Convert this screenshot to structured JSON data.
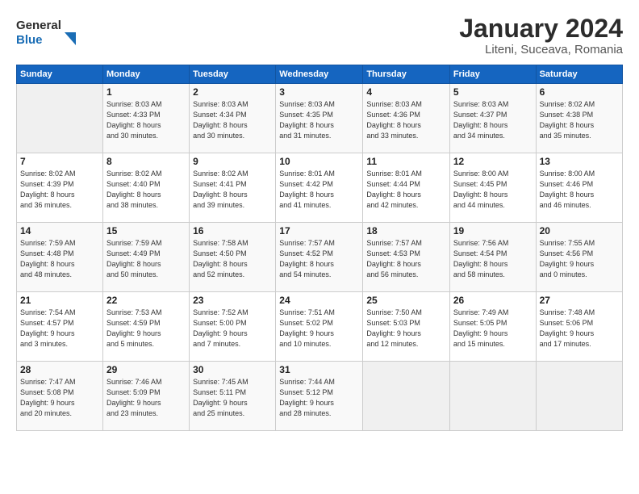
{
  "header": {
    "logo_general": "General",
    "logo_blue": "Blue",
    "title": "January 2024",
    "subtitle": "Liteni, Suceava, Romania"
  },
  "columns": [
    "Sunday",
    "Monday",
    "Tuesday",
    "Wednesday",
    "Thursday",
    "Friday",
    "Saturday"
  ],
  "weeks": [
    [
      {
        "num": "",
        "detail": ""
      },
      {
        "num": "1",
        "detail": "Sunrise: 8:03 AM\nSunset: 4:33 PM\nDaylight: 8 hours\nand 30 minutes."
      },
      {
        "num": "2",
        "detail": "Sunrise: 8:03 AM\nSunset: 4:34 PM\nDaylight: 8 hours\nand 30 minutes."
      },
      {
        "num": "3",
        "detail": "Sunrise: 8:03 AM\nSunset: 4:35 PM\nDaylight: 8 hours\nand 31 minutes."
      },
      {
        "num": "4",
        "detail": "Sunrise: 8:03 AM\nSunset: 4:36 PM\nDaylight: 8 hours\nand 33 minutes."
      },
      {
        "num": "5",
        "detail": "Sunrise: 8:03 AM\nSunset: 4:37 PM\nDaylight: 8 hours\nand 34 minutes."
      },
      {
        "num": "6",
        "detail": "Sunrise: 8:02 AM\nSunset: 4:38 PM\nDaylight: 8 hours\nand 35 minutes."
      }
    ],
    [
      {
        "num": "7",
        "detail": "Sunrise: 8:02 AM\nSunset: 4:39 PM\nDaylight: 8 hours\nand 36 minutes."
      },
      {
        "num": "8",
        "detail": "Sunrise: 8:02 AM\nSunset: 4:40 PM\nDaylight: 8 hours\nand 38 minutes."
      },
      {
        "num": "9",
        "detail": "Sunrise: 8:02 AM\nSunset: 4:41 PM\nDaylight: 8 hours\nand 39 minutes."
      },
      {
        "num": "10",
        "detail": "Sunrise: 8:01 AM\nSunset: 4:42 PM\nDaylight: 8 hours\nand 41 minutes."
      },
      {
        "num": "11",
        "detail": "Sunrise: 8:01 AM\nSunset: 4:44 PM\nDaylight: 8 hours\nand 42 minutes."
      },
      {
        "num": "12",
        "detail": "Sunrise: 8:00 AM\nSunset: 4:45 PM\nDaylight: 8 hours\nand 44 minutes."
      },
      {
        "num": "13",
        "detail": "Sunrise: 8:00 AM\nSunset: 4:46 PM\nDaylight: 8 hours\nand 46 minutes."
      }
    ],
    [
      {
        "num": "14",
        "detail": "Sunrise: 7:59 AM\nSunset: 4:48 PM\nDaylight: 8 hours\nand 48 minutes."
      },
      {
        "num": "15",
        "detail": "Sunrise: 7:59 AM\nSunset: 4:49 PM\nDaylight: 8 hours\nand 50 minutes."
      },
      {
        "num": "16",
        "detail": "Sunrise: 7:58 AM\nSunset: 4:50 PM\nDaylight: 8 hours\nand 52 minutes."
      },
      {
        "num": "17",
        "detail": "Sunrise: 7:57 AM\nSunset: 4:52 PM\nDaylight: 8 hours\nand 54 minutes."
      },
      {
        "num": "18",
        "detail": "Sunrise: 7:57 AM\nSunset: 4:53 PM\nDaylight: 8 hours\nand 56 minutes."
      },
      {
        "num": "19",
        "detail": "Sunrise: 7:56 AM\nSunset: 4:54 PM\nDaylight: 8 hours\nand 58 minutes."
      },
      {
        "num": "20",
        "detail": "Sunrise: 7:55 AM\nSunset: 4:56 PM\nDaylight: 9 hours\nand 0 minutes."
      }
    ],
    [
      {
        "num": "21",
        "detail": "Sunrise: 7:54 AM\nSunset: 4:57 PM\nDaylight: 9 hours\nand 3 minutes."
      },
      {
        "num": "22",
        "detail": "Sunrise: 7:53 AM\nSunset: 4:59 PM\nDaylight: 9 hours\nand 5 minutes."
      },
      {
        "num": "23",
        "detail": "Sunrise: 7:52 AM\nSunset: 5:00 PM\nDaylight: 9 hours\nand 7 minutes."
      },
      {
        "num": "24",
        "detail": "Sunrise: 7:51 AM\nSunset: 5:02 PM\nDaylight: 9 hours\nand 10 minutes."
      },
      {
        "num": "25",
        "detail": "Sunrise: 7:50 AM\nSunset: 5:03 PM\nDaylight: 9 hours\nand 12 minutes."
      },
      {
        "num": "26",
        "detail": "Sunrise: 7:49 AM\nSunset: 5:05 PM\nDaylight: 9 hours\nand 15 minutes."
      },
      {
        "num": "27",
        "detail": "Sunrise: 7:48 AM\nSunset: 5:06 PM\nDaylight: 9 hours\nand 17 minutes."
      }
    ],
    [
      {
        "num": "28",
        "detail": "Sunrise: 7:47 AM\nSunset: 5:08 PM\nDaylight: 9 hours\nand 20 minutes."
      },
      {
        "num": "29",
        "detail": "Sunrise: 7:46 AM\nSunset: 5:09 PM\nDaylight: 9 hours\nand 23 minutes."
      },
      {
        "num": "30",
        "detail": "Sunrise: 7:45 AM\nSunset: 5:11 PM\nDaylight: 9 hours\nand 25 minutes."
      },
      {
        "num": "31",
        "detail": "Sunrise: 7:44 AM\nSunset: 5:12 PM\nDaylight: 9 hours\nand 28 minutes."
      },
      {
        "num": "",
        "detail": ""
      },
      {
        "num": "",
        "detail": ""
      },
      {
        "num": "",
        "detail": ""
      }
    ]
  ]
}
